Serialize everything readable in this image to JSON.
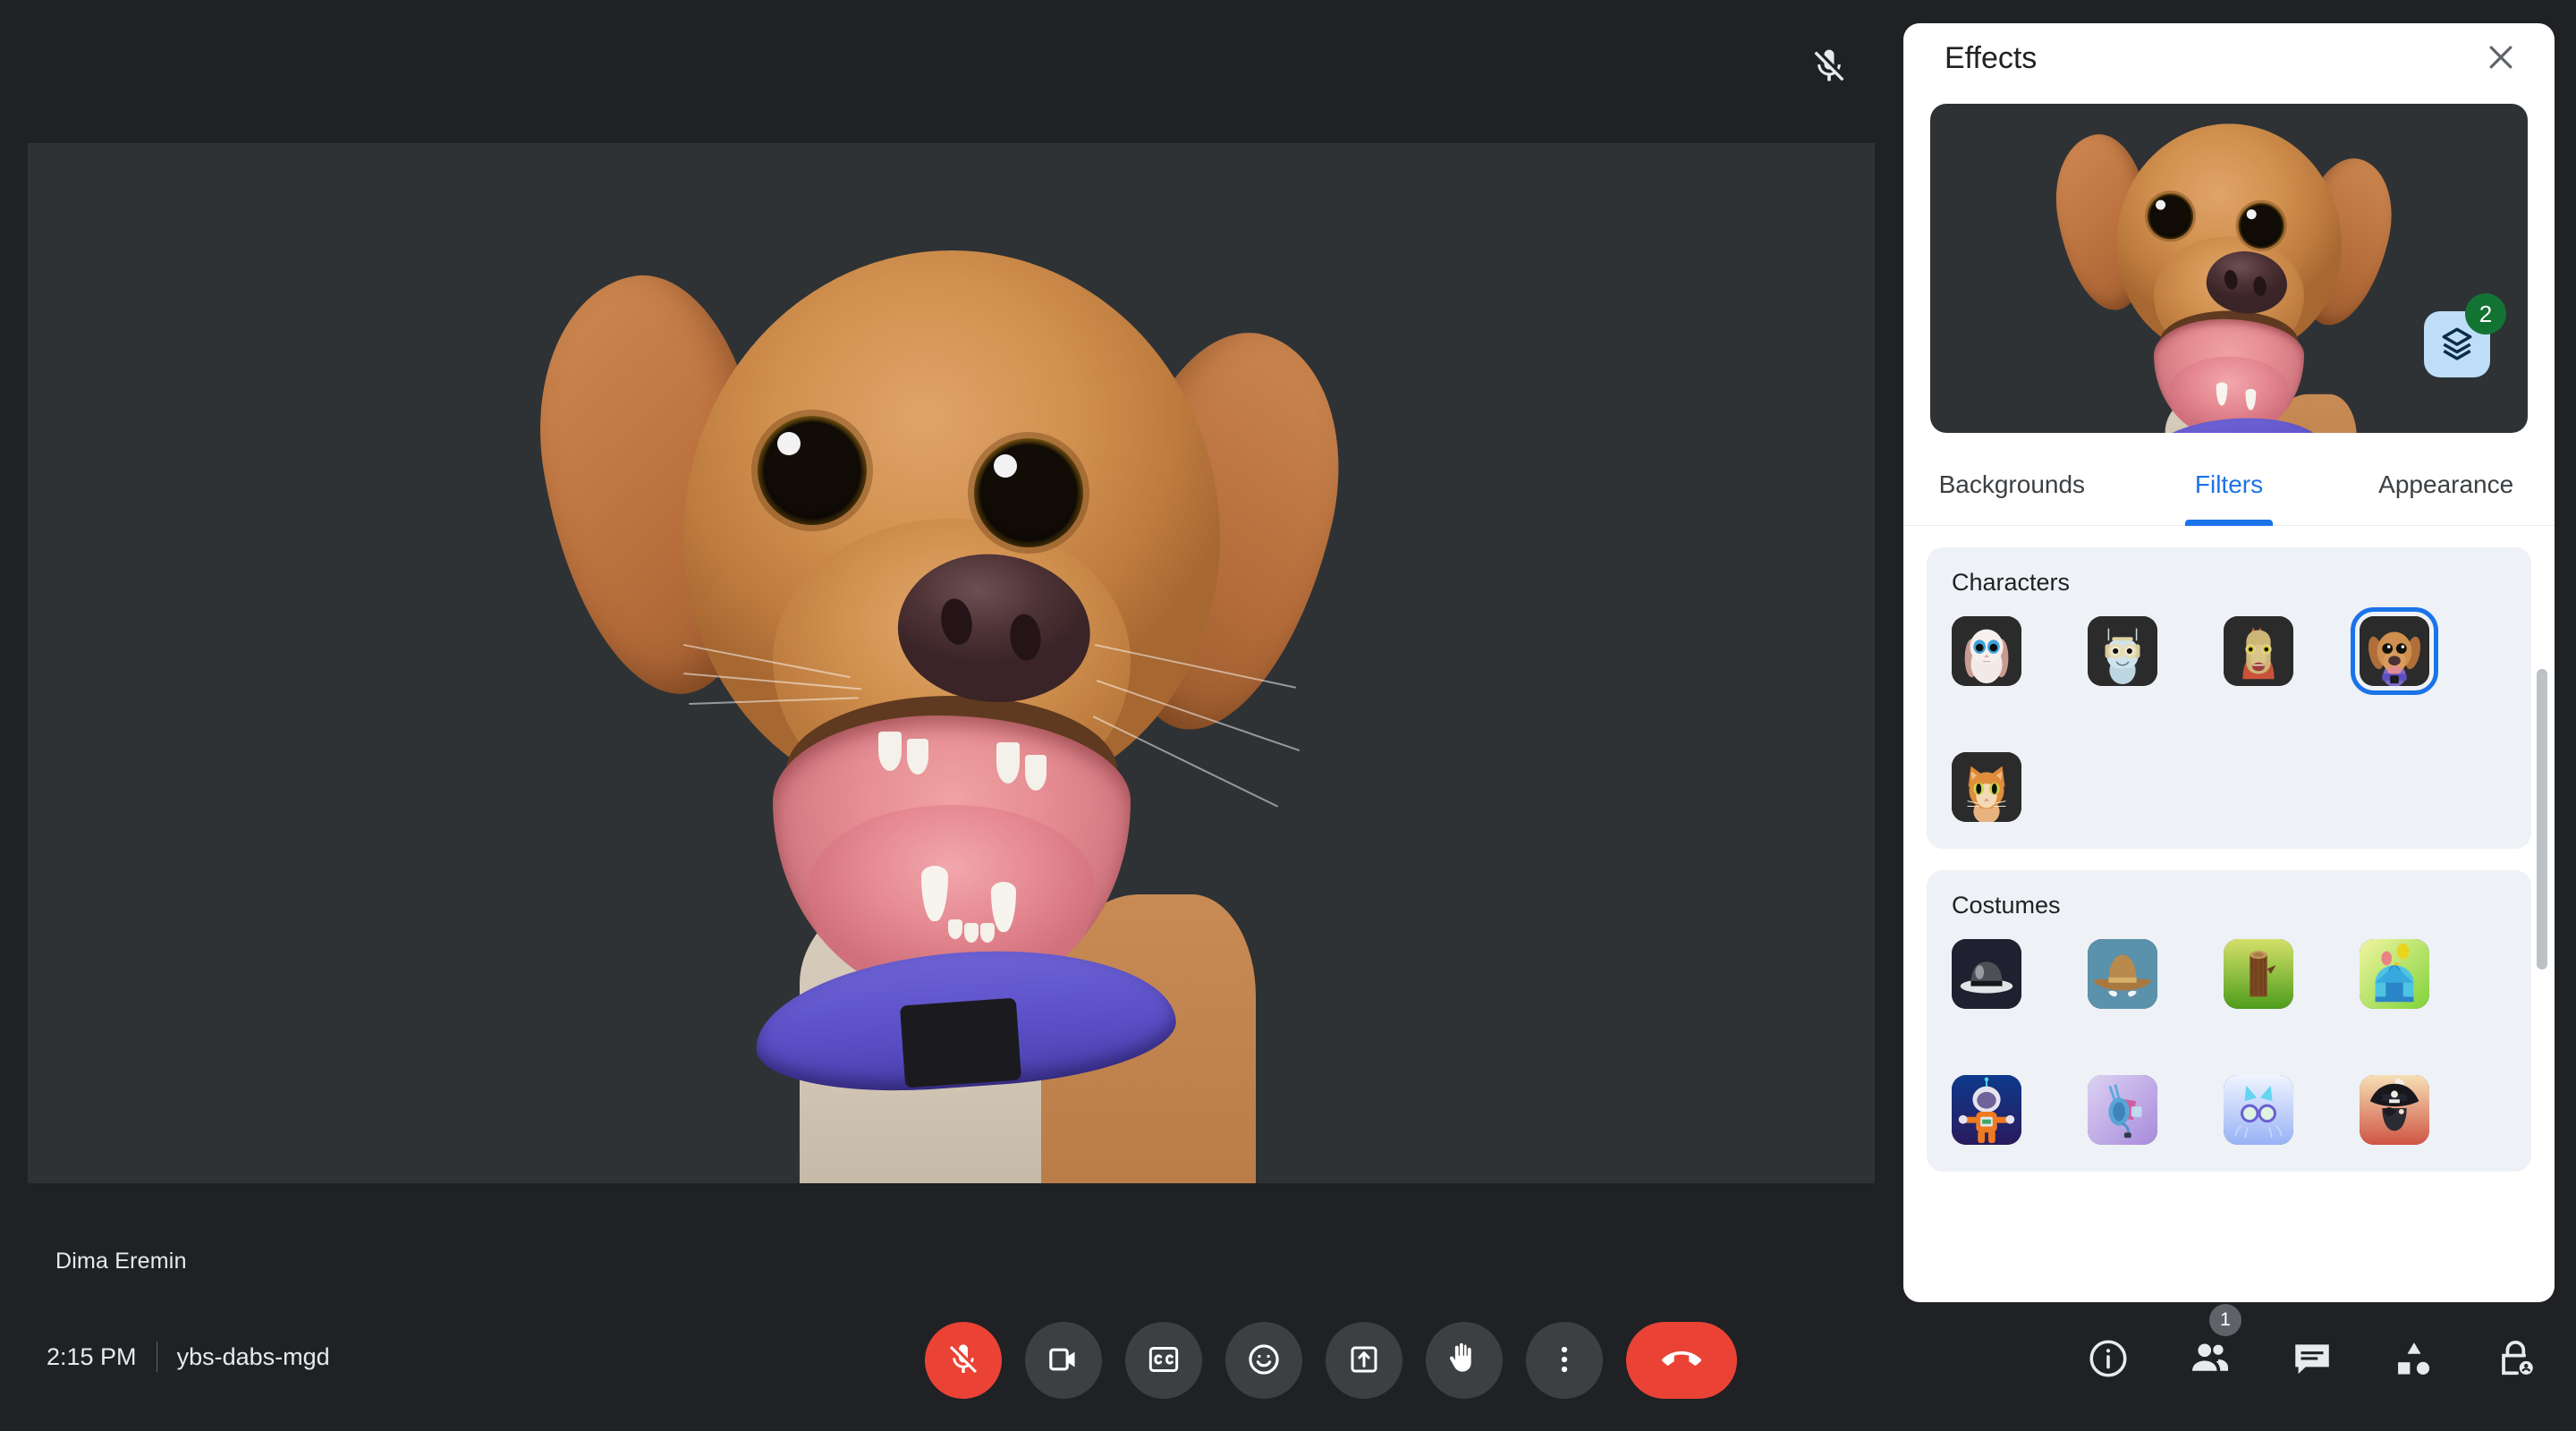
{
  "meeting": {
    "participant_name": "Dima Eremin",
    "time": "2:15 PM",
    "meeting_code": "ybs-dabs-mgd",
    "mic_status": "muted"
  },
  "controls": [
    {
      "name": "microphone",
      "label": "Turn on microphone",
      "icon": "mic-off-icon",
      "state": "off"
    },
    {
      "name": "camera",
      "label": "Turn off camera",
      "icon": "video-camera-icon",
      "state": "on"
    },
    {
      "name": "captions",
      "label": "Turn on captions",
      "icon": "closed-caption-icon",
      "state": "off"
    },
    {
      "name": "reactions",
      "label": "Send a reaction",
      "icon": "emoji-smiley-icon",
      "state": "off"
    },
    {
      "name": "present",
      "label": "Present now",
      "icon": "present-screen-icon",
      "state": "off"
    },
    {
      "name": "raise-hand",
      "label": "Raise hand",
      "icon": "raised-hand-icon",
      "state": "off"
    },
    {
      "name": "more-options",
      "label": "More options",
      "icon": "more-vert-icon",
      "state": "off"
    },
    {
      "name": "end-call",
      "label": "Leave call",
      "icon": "call-end-icon",
      "state": "on"
    }
  ],
  "right_controls": [
    {
      "name": "meeting-details",
      "label": "Meeting details",
      "icon": "info-icon",
      "badge": null
    },
    {
      "name": "people",
      "label": "People",
      "icon": "people-icon",
      "badge": "1"
    },
    {
      "name": "chat",
      "label": "Chat with everyone",
      "icon": "chat-bubble-icon",
      "badge": null
    },
    {
      "name": "activities",
      "label": "Activities",
      "icon": "activities-shapes-icon",
      "badge": null
    },
    {
      "name": "host-controls",
      "label": "Host controls",
      "icon": "lock-person-icon",
      "badge": null
    }
  ],
  "effects_panel": {
    "title": "Effects",
    "close_label": "Close",
    "preview": {
      "layers_button_label": "Layers",
      "layers_icon": "layers-icon",
      "layers_count": "2",
      "badge_color": "#137333"
    },
    "tabs": [
      {
        "label": "Backgrounds",
        "active": false
      },
      {
        "label": "Filters",
        "active": true
      },
      {
        "label": "Appearance",
        "active": false
      }
    ],
    "accent_color": "#1a73e8",
    "sections": [
      {
        "title": "Characters",
        "items": [
          {
            "name": "rabbit",
            "label": "Rabbit",
            "selected": false
          },
          {
            "name": "robot",
            "label": "Robot",
            "selected": false
          },
          {
            "name": "dinosaur",
            "label": "Dinosaur",
            "selected": false
          },
          {
            "name": "dog",
            "label": "Dog",
            "selected": true
          },
          {
            "name": "cat",
            "label": "Cat",
            "selected": false
          }
        ]
      },
      {
        "title": "Costumes",
        "items": [
          {
            "name": "fedora-hat",
            "label": "Fedora hat",
            "selected": false
          },
          {
            "name": "cowboy-hat",
            "label": "Cowboy hat and mustache",
            "selected": false
          },
          {
            "name": "tree-stump",
            "label": "Tree stump",
            "selected": false
          },
          {
            "name": "circus-tent",
            "label": "Circus tent",
            "selected": false
          },
          {
            "name": "astronaut",
            "label": "Astronaut",
            "selected": false
          },
          {
            "name": "gaming-headset",
            "label": "Gaming headset",
            "selected": false
          },
          {
            "name": "cat-glasses",
            "label": "Cat glasses",
            "selected": false
          },
          {
            "name": "pirate-hat",
            "label": "Pirate hat",
            "selected": false
          }
        ]
      }
    ]
  }
}
